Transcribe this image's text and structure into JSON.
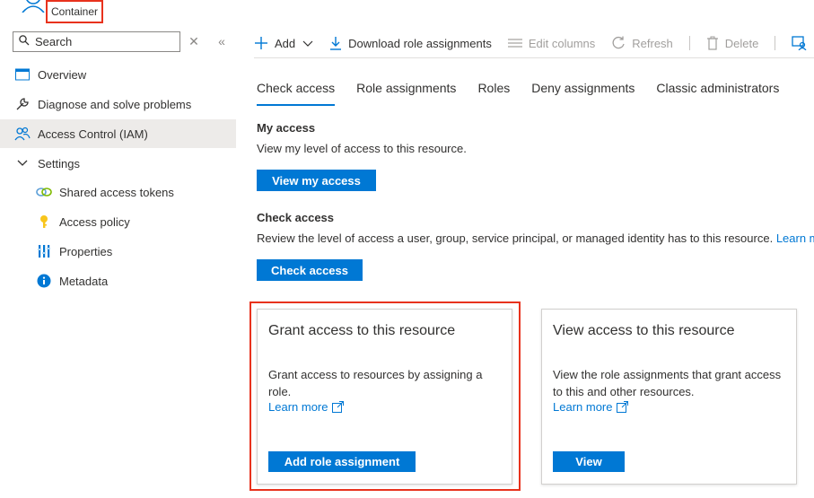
{
  "header": {
    "resource_type": "Container"
  },
  "sidebar": {
    "search_placeholder": "Search",
    "items": [
      {
        "label": "Overview",
        "icon": "overview-icon"
      },
      {
        "label": "Diagnose and solve problems",
        "icon": "wrench-icon"
      },
      {
        "label": "Access Control (IAM)",
        "icon": "people-icon",
        "active": true
      },
      {
        "label": "Settings",
        "icon": "chevron-down-icon"
      },
      {
        "label": "Shared access tokens",
        "icon": "link-icon"
      },
      {
        "label": "Access policy",
        "icon": "key-icon"
      },
      {
        "label": "Properties",
        "icon": "properties-icon"
      },
      {
        "label": "Metadata",
        "icon": "info-icon"
      }
    ]
  },
  "toolbar": {
    "add": "Add",
    "download": "Download role assignments",
    "edit_columns": "Edit columns",
    "refresh": "Refresh",
    "delete": "Delete"
  },
  "tabs": [
    "Check access",
    "Role assignments",
    "Roles",
    "Deny assignments",
    "Classic administrators"
  ],
  "my_access": {
    "title": "My access",
    "desc": "View my level of access to this resource.",
    "button": "View my access"
  },
  "check_access": {
    "title": "Check access",
    "desc": "Review the level of access a user, group, service principal, or managed identity has to this resource.",
    "link": "Learn mo",
    "button": "Check access"
  },
  "cards": [
    {
      "title": "Grant access to this resource",
      "desc_line1": "Grant access to resources by assigning a",
      "desc_line2": "role.",
      "link": "Learn more",
      "button": "Add role assignment"
    },
    {
      "title": "View access to this resource",
      "desc_line1": "View the role assignments that grant access",
      "desc_line2": "to this and other resources.",
      "link": "Learn more",
      "button": "View"
    }
  ],
  "colors": {
    "accent": "#0078d4",
    "highlight": "#e8321d"
  }
}
